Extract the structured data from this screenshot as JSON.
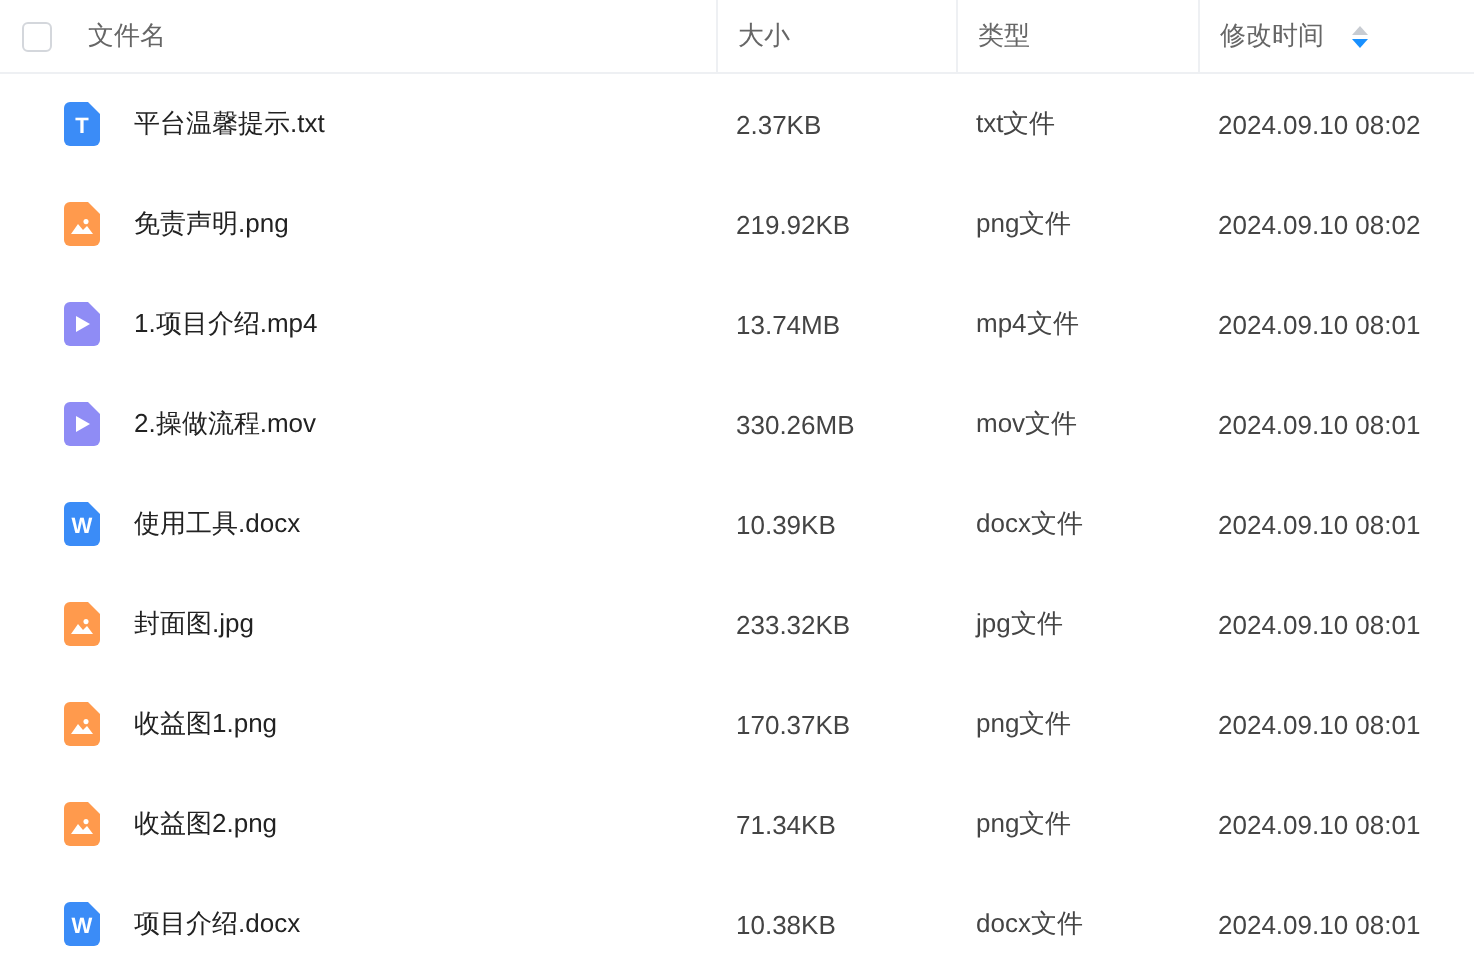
{
  "header": {
    "select_all": {
      "checked": false
    },
    "columns": [
      {
        "label": "文件名",
        "sorted": false
      },
      {
        "label": "大小",
        "sorted": false
      },
      {
        "label": "类型",
        "sorted": false
      },
      {
        "label": "修改时间",
        "sorted": true
      }
    ]
  },
  "rows": [
    {
      "kind": "text",
      "icon_text": "T",
      "name": "平台温馨提示.txt",
      "size": "2.37KB",
      "type": "txt文件",
      "modified": "2024.09.10 08:02"
    },
    {
      "kind": "image",
      "name": "免责声明.png",
      "size": "219.92KB",
      "type": "png文件",
      "modified": "2024.09.10 08:02"
    },
    {
      "kind": "video",
      "name": "1.项目介绍.mp4",
      "size": "13.74MB",
      "type": "mp4文件",
      "modified": "2024.09.10 08:01"
    },
    {
      "kind": "video",
      "name": "2.操做流程.mov",
      "size": "330.26MB",
      "type": "mov文件",
      "modified": "2024.09.10 08:01"
    },
    {
      "kind": "word",
      "icon_text": "W",
      "name": "使用工具.docx",
      "size": "10.39KB",
      "type": "docx文件",
      "modified": "2024.09.10 08:01"
    },
    {
      "kind": "image",
      "name": "封面图.jpg",
      "size": "233.32KB",
      "type": "jpg文件",
      "modified": "2024.09.10 08:01"
    },
    {
      "kind": "image",
      "name": "收益图1.png",
      "size": "170.37KB",
      "type": "png文件",
      "modified": "2024.09.10 08:01"
    },
    {
      "kind": "image",
      "name": "收益图2.png",
      "size": "71.34KB",
      "type": "png文件",
      "modified": "2024.09.10 08:01"
    },
    {
      "kind": "word",
      "icon_text": "W",
      "name": "项目介绍.docx",
      "size": "10.38KB",
      "type": "docx文件",
      "modified": "2024.09.10 08:01"
    }
  ]
}
